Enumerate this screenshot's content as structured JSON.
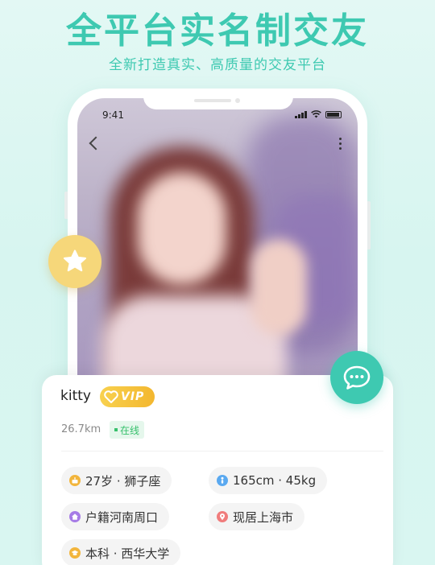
{
  "promo": {
    "headline": "全平台实名制交友",
    "subline": "全新打造真实、高质量的交友平台"
  },
  "status_bar": {
    "time": "9:41"
  },
  "profile": {
    "name": "kitty",
    "vip_label": "VIP",
    "distance": "26.7km",
    "online_status": "在线",
    "tags": [
      {
        "icon": "age-icon",
        "text": "27岁 · 狮子座",
        "color": "#f2b53c"
      },
      {
        "icon": "body-icon",
        "text": "165cm · 45kg",
        "color": "#5aa9f0"
      },
      {
        "icon": "home-icon",
        "text": "户籍河南周口",
        "color": "#a67be6"
      },
      {
        "icon": "location-icon",
        "text": "现居上海市",
        "color": "#f07c7c"
      },
      {
        "icon": "education-icon",
        "text": "本科 · 西华大学",
        "color": "#f2b53c"
      }
    ]
  },
  "colors": {
    "accent": "#3ec9b1",
    "vip": "#f3b72f",
    "online": "#37c06c",
    "star_badge": "#f6d77a"
  }
}
